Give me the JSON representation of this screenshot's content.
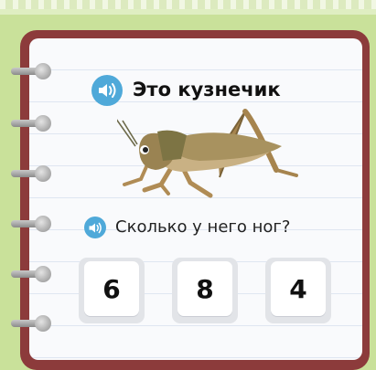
{
  "title": "Это кузнечик",
  "question": "Сколько у него ног?",
  "answers": [
    {
      "label": "6"
    },
    {
      "label": "8"
    },
    {
      "label": "4"
    }
  ],
  "icons": {
    "title_audio": "speaker-icon",
    "question_audio": "speaker-icon",
    "picture": "grasshopper"
  },
  "colors": {
    "background": "#c9e19a",
    "notebook_cover": "#8c3b3b",
    "page": "#f9fafc",
    "speaker": "#4fa9d9",
    "answer_shadow": "#e2e4e8"
  }
}
